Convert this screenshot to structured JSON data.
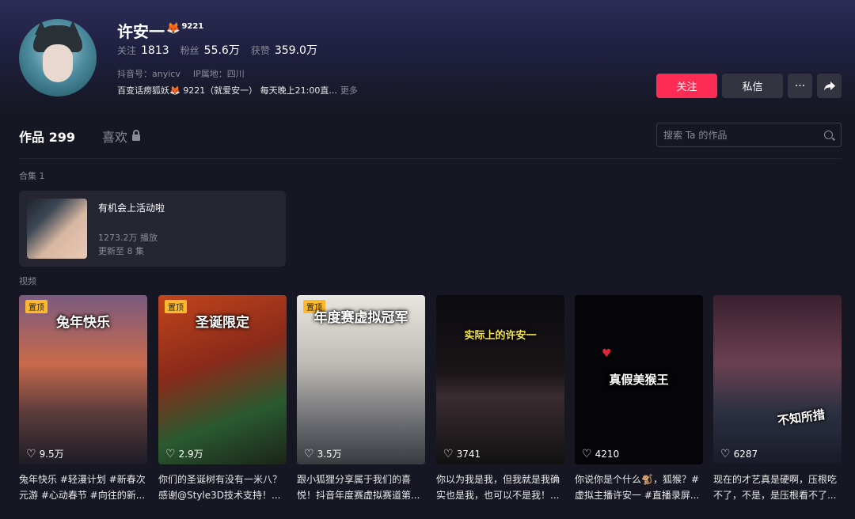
{
  "profile": {
    "name": "许安一",
    "name_emoji": "🦊",
    "name_num": "9221",
    "following_label": "关注",
    "following": "1813",
    "followers_label": "粉丝",
    "followers": "55.6万",
    "likes_label": "获赞",
    "likes": "359.0万",
    "douyin_id": "抖音号：anyicv",
    "ip": "IP属地：四川",
    "bio": "百变话痨狐妖🦊 9221（就爱安一） 每天晚上21:00直...",
    "bio_more": "更多"
  },
  "actions": {
    "follow": "关注",
    "message": "私信",
    "more": "···"
  },
  "tabs": {
    "works": "作品 299",
    "likes": "喜欢"
  },
  "search": {
    "placeholder": "搜索 Ta 的作品"
  },
  "collection": {
    "section_title": "合集 1",
    "name": "有机会上活动啦",
    "plays": "1273.2万 播放",
    "updated": "更新至 8 集"
  },
  "videos_title": "视频",
  "videos": [
    {
      "pinned": "置顶",
      "overlay": "兔年快乐",
      "likes": "9.5万",
      "desc": "兔年快乐 #轻漫计划 #新春次元游 #心动春节 #向往的新..."
    },
    {
      "pinned": "置顶",
      "overlay": "圣诞限定",
      "likes": "2.9万",
      "desc": "你们的圣诞树有没有一米八？感谢@Style3D技术支持！..."
    },
    {
      "pinned": "置顶",
      "overlay": "年度赛虚拟冠军",
      "likes": "3.5万",
      "desc": "跟小狐狸分享属于我们的喜悦！抖音年度赛虚拟赛道第..."
    },
    {
      "pinned": "",
      "overlay": "实际上的许安一",
      "likes": "3741",
      "desc": "你以为我是我，但我就是我确实也是我，也可以不是我！..."
    },
    {
      "pinned": "",
      "overlay": "真假美猴王",
      "likes": "4210",
      "desc": "你说你是个什么🐒，狐猴？#虚拟主播许安一 #直播录屏..."
    },
    {
      "pinned": "",
      "overlay": "不知所措",
      "likes": "6287",
      "desc": "现在的才艺真是硬啊，压根吃不了，不是，是压根看不了..."
    }
  ],
  "colors": {
    "accent": "#fe2c55",
    "background": "#161722",
    "pin": "#fdb82b"
  }
}
